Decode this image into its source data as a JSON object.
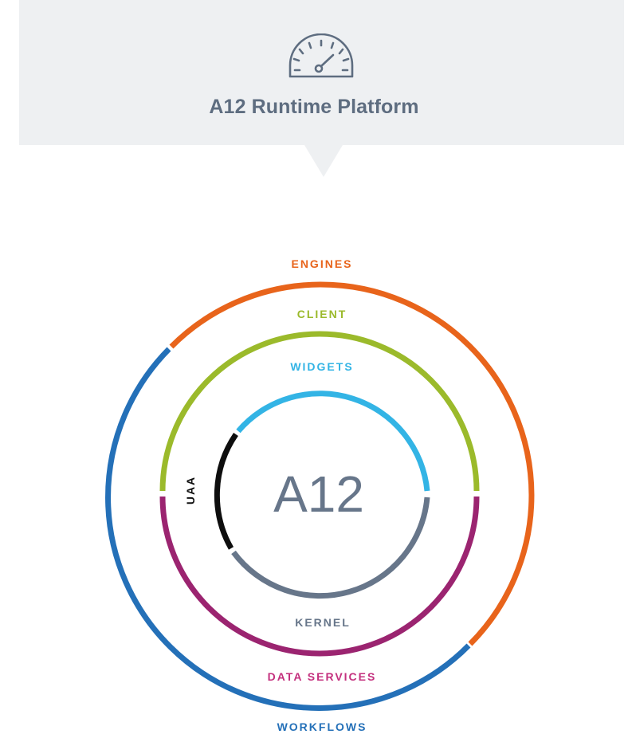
{
  "header": {
    "icon": "speedometer-icon",
    "title": "A12 Runtime Platform",
    "background": "#eef0f2"
  },
  "diagram": {
    "center_label": "A12",
    "labels": {
      "engines": "ENGINES",
      "client": "CLIENT",
      "widgets": "WIDGETS",
      "uaa": "UAA",
      "kernel": "KERNEL",
      "data_services": "DATA SERVICES",
      "workflows": "WORKFLOWS"
    },
    "colors": {
      "engines": "#e8641b",
      "client": "#9bba2b",
      "widgets": "#33b4e5",
      "uaa": "#0e0e0e",
      "kernel": "#67768a",
      "data_services": "#9b2470",
      "data_services_label": "#c4307e",
      "workflows": "#2470b8",
      "center_text": "#67768a",
      "title": "#5e6d80"
    }
  }
}
